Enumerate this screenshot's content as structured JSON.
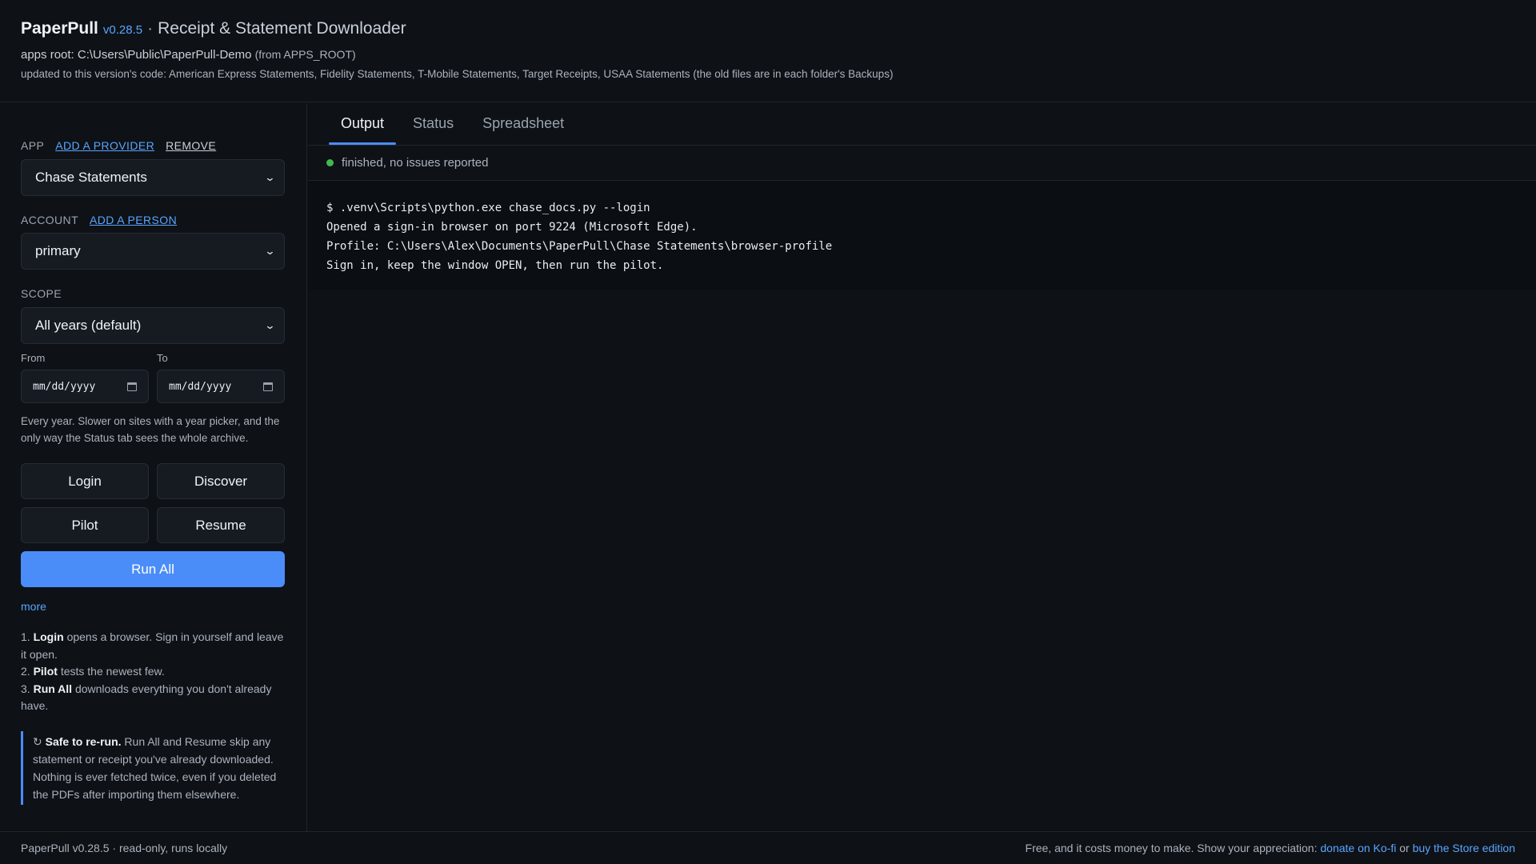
{
  "header": {
    "app_name": "PaperPull",
    "version": "v0.28.5",
    "separator": "·",
    "subtitle": "Receipt & Statement Downloader",
    "apps_root_label": "apps root:",
    "apps_root_path": "C:\\Users\\Public\\PaperPull-Demo",
    "apps_root_source": "(from APPS_ROOT)",
    "updated_note": "updated to this version's code: American Express Statements, Fidelity Statements, T-Mobile Statements, Target Receipts, USAA Statements (the old files are in each folder's Backups)"
  },
  "sidebar": {
    "app_label": "APP",
    "add_provider": "ADD A PROVIDER",
    "remove": "REMOVE",
    "app_value": "Chase Statements",
    "account_label": "ACCOUNT",
    "add_person": "ADD A PERSON",
    "account_value": "primary",
    "scope_label": "SCOPE",
    "scope_value": "All years (default)",
    "from_label": "From",
    "to_label": "To",
    "from_placeholder": "mm/dd/yyyy",
    "to_placeholder": "mm/dd/yyyy",
    "scope_help": "Every year. Slower on sites with a year picker, and the only way the Status tab sees the whole archive.",
    "buttons": {
      "login": "Login",
      "discover": "Discover",
      "pilot": "Pilot",
      "resume": "Resume",
      "run_all": "Run All"
    },
    "more": "more",
    "steps": [
      {
        "num": "1.",
        "bold": "Login",
        "text": "opens a browser. Sign in yourself and leave it open."
      },
      {
        "num": "2.",
        "bold": "Pilot",
        "text": "tests the newest few."
      },
      {
        "num": "3.",
        "bold": "Run All",
        "text": "downloads everything you don't already have."
      }
    ],
    "callout_icon": "↻",
    "callout_bold": "Safe to re-run.",
    "callout_text": "Run All and Resume skip any statement or receipt you've already downloaded. Nothing is ever fetched twice, even if you deleted the PDFs after importing them elsewhere."
  },
  "main": {
    "tabs": [
      {
        "label": "Output",
        "active": true
      },
      {
        "label": "Status",
        "active": false
      },
      {
        "label": "Spreadsheet",
        "active": false
      }
    ],
    "status_text": "finished, no issues reported",
    "status_color": "#3fb950",
    "console_lines": [
      "$ .venv\\Scripts\\python.exe chase_docs.py --login",
      "Opened a sign-in browser on port 9224 (Microsoft Edge).",
      "Profile: C:\\Users\\Alex\\Documents\\PaperPull\\Chase Statements\\browser-profile",
      "Sign in, keep the window OPEN, then run the pilot."
    ]
  },
  "footer": {
    "left": "PaperPull v0.28.5 · read-only, runs locally",
    "right_text": "Free, and it costs money to make. Show your appreciation:",
    "kofi_link": "donate on Ko-fi",
    "or": "or",
    "store_link": "buy the Store edition"
  },
  "colors": {
    "accent": "#4b8df8",
    "background": "#0e1116",
    "success": "#3fb950"
  }
}
